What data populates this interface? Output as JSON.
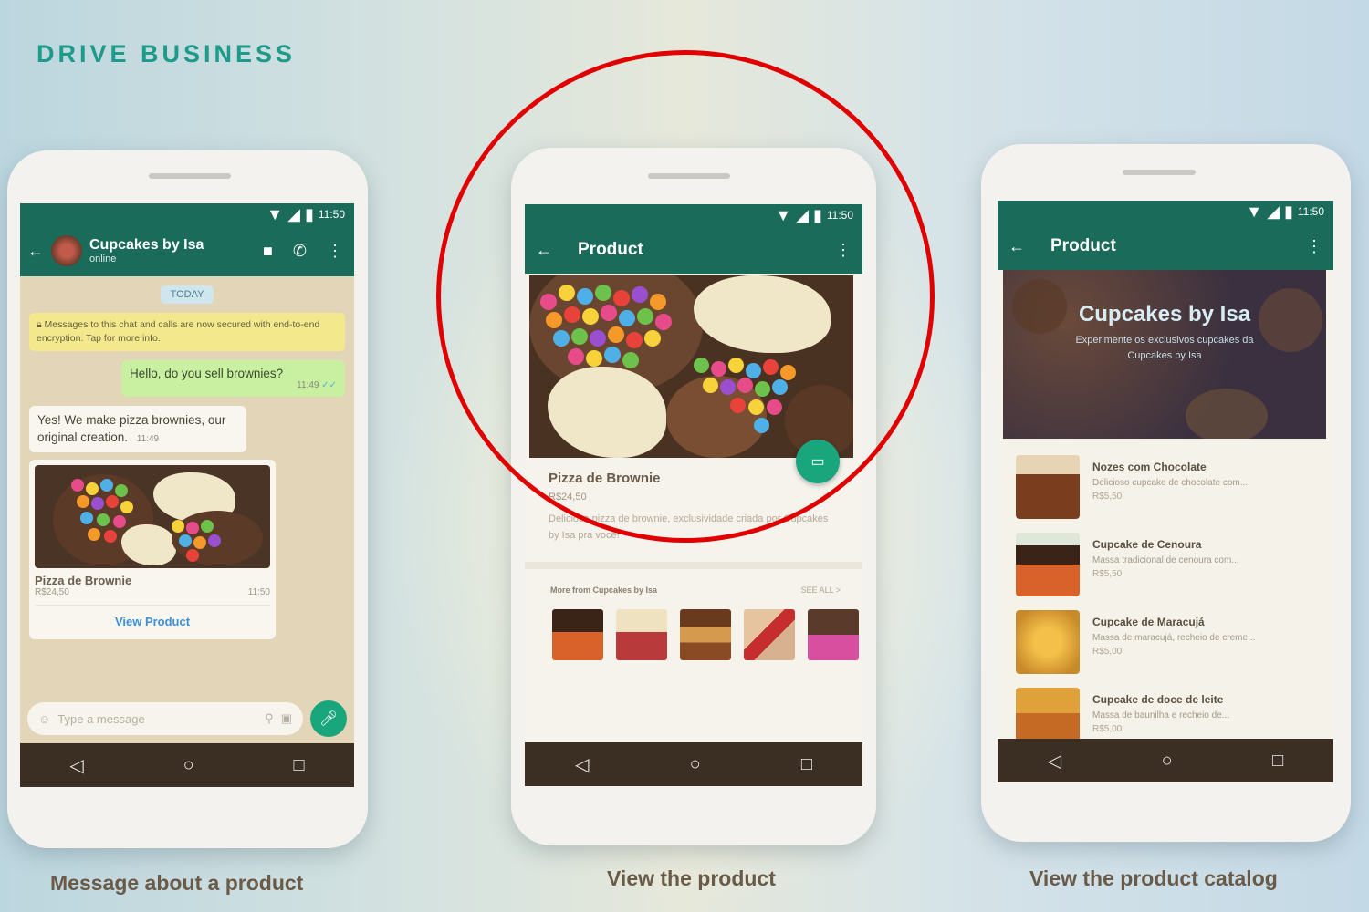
{
  "header": {
    "title": "DRIVE BUSINESS"
  },
  "phone1": {
    "status_time": "11:50",
    "contact_name": "Cupcakes by Isa",
    "contact_status": "online",
    "date_chip": "TODAY",
    "encryption_notice": "Messages to this chat and calls are now secured with end-to-end encryption. Tap for more info.",
    "outgoing_message": "Hello, do you sell brownies?",
    "outgoing_time": "11:49",
    "incoming_message": "Yes! We make pizza brownies, our original creation.",
    "incoming_time": "11:49",
    "product_name": "Pizza de Brownie",
    "product_price": "R$24,50",
    "product_time": "11:50",
    "view_product_label": "View Product",
    "input_placeholder": "Type a message",
    "caption": "Message about a product"
  },
  "phone2": {
    "status_time": "11:50",
    "appbar_title": "Product",
    "product_name": "Pizza de Brownie",
    "product_price": "R$24,50",
    "product_description": "Deliciosa pizza de brownie, exclusividade criada por Cupcakes by Isa pra você!",
    "more_from_label": "More from Cupcakes by Isa",
    "see_all_label": "SEE ALL >",
    "caption": "View the product"
  },
  "phone3": {
    "status_time": "11:50",
    "appbar_title": "Product",
    "store_name": "Cupcakes by Isa",
    "store_tagline": "Experimente os exclusivos cupcakes da Cupcakes by Isa",
    "catalog": [
      {
        "name": "Nozes com Chocolate",
        "desc": "Delicioso cupcake de chocolate com...",
        "price": "R$5,50"
      },
      {
        "name": "Cupcake de Cenoura",
        "desc": "Massa tradicional de cenoura com...",
        "price": "R$5,50"
      },
      {
        "name": "Cupcake de Maracujá",
        "desc": "Massa de maracujá, recheio de creme...",
        "price": "R$5,00"
      },
      {
        "name": "Cupcake de doce de leite",
        "desc": "Massa de baunilha e recheio de...",
        "price": "R$5,00"
      }
    ],
    "caption": "View the product catalog"
  },
  "colors": {
    "whatsapp_header": "#1a6b5a",
    "accent_green": "#1aa67c",
    "highlight_circle": "#e00000",
    "title_teal": "#1c9b8a"
  }
}
